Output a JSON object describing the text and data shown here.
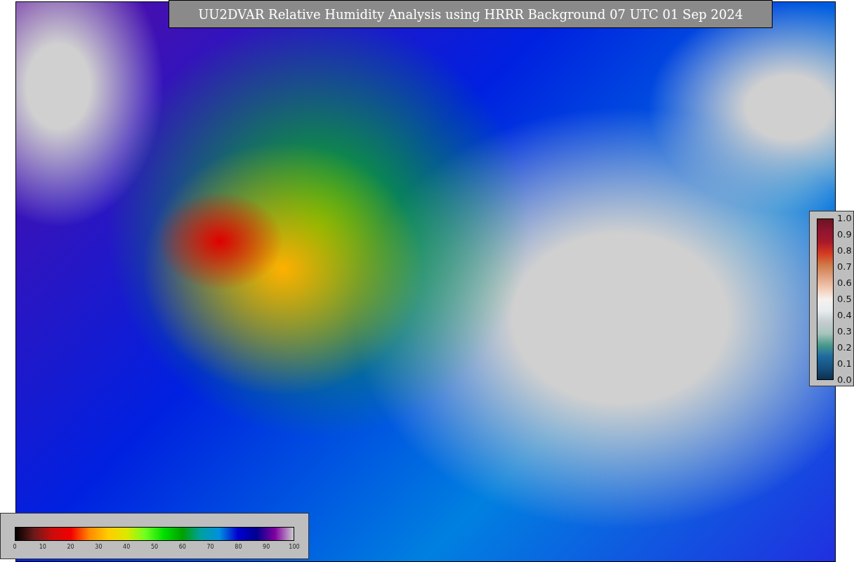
{
  "title": "UU2DVAR Relative Humidity Analysis using HRRR Background 07 UTC 01 Sep 2024",
  "humidity_colorbar": {
    "ticks": [
      "0",
      "10",
      "20",
      "30",
      "40",
      "50",
      "60",
      "70",
      "80",
      "90",
      "100"
    ]
  },
  "weight_colorbar": {
    "ticks": [
      "1.0",
      "0.9",
      "0.8",
      "0.7",
      "0.6",
      "0.5",
      "0.4",
      "0.3",
      "0.2",
      "0.1",
      "0.0"
    ]
  }
}
